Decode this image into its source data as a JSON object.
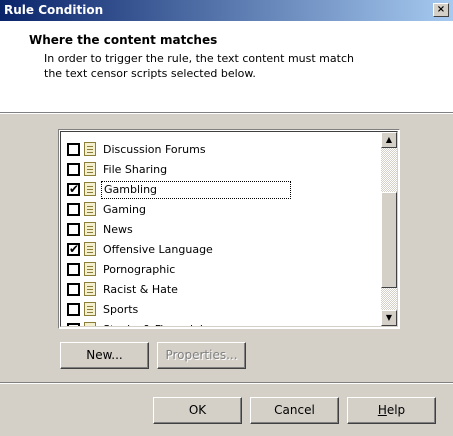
{
  "window": {
    "title": "Rule Condition",
    "close_glyph": "×"
  },
  "header": {
    "title": "Where the content matches",
    "description": "In order to trigger the rule, the text content must match the text censor scripts selected below."
  },
  "list": {
    "items": [
      {
        "label": "Discussion Forums",
        "checked": false
      },
      {
        "label": "File Sharing",
        "checked": false
      },
      {
        "label": "Gambling",
        "checked": true,
        "focused": true
      },
      {
        "label": "Gaming",
        "checked": false
      },
      {
        "label": "News",
        "checked": false
      },
      {
        "label": "Offensive Language",
        "checked": true
      },
      {
        "label": "Pornographic",
        "checked": false
      },
      {
        "label": "Racist & Hate",
        "checked": false
      },
      {
        "label": "Sports",
        "checked": false
      },
      {
        "label": "Stocks & Financial",
        "checked": false
      }
    ],
    "item_icon": "text-document-icon",
    "checkmark": "✔",
    "scroll_up_glyph": "▲",
    "scroll_down_glyph": "▼"
  },
  "buttons": {
    "new": "New...",
    "properties": "Properties...",
    "ok": "OK",
    "cancel": "Cancel",
    "help": "Help"
  }
}
